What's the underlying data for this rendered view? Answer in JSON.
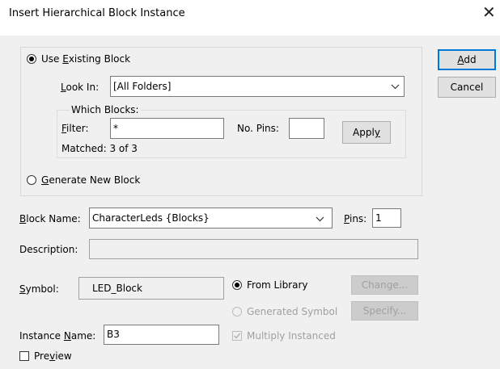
{
  "window": {
    "title": "Insert Hierarchical Block Instance",
    "close_glyph": "✕"
  },
  "use_existing": {
    "label": "Use Existing Block",
    "selected": true
  },
  "look_in": {
    "label": "Look In:",
    "value": "[All Folders]"
  },
  "which_blocks": {
    "legend": "Which Blocks:",
    "filter_label": "Filter:",
    "filter_value": "*",
    "pins_label": "No. Pins:",
    "pins_value": "",
    "apply_label": "Apply",
    "matched": "Matched: 3 of 3"
  },
  "generate_new": {
    "label": "Generate New Block",
    "selected": false
  },
  "block_name": {
    "label": "Block Name:",
    "value": "CharacterLeds {Blocks}"
  },
  "pins": {
    "label": "Pins:",
    "value": "1"
  },
  "description": {
    "label": "Description:",
    "value": ""
  },
  "symbol": {
    "label": "Symbol:",
    "value": "LED_Block"
  },
  "from_library": {
    "label": "From Library",
    "selected": true
  },
  "generated_symbol": {
    "label": "Generated Symbol",
    "selected": false
  },
  "change_label": "Change...",
  "specify_label": "Specify...",
  "instance_name": {
    "label": "Instance Name:",
    "value": "B3"
  },
  "multiply_instanced": {
    "label": "Multiply Instanced",
    "checked": true
  },
  "preview": {
    "label": "Preview",
    "checked": false
  },
  "buttons": {
    "add": "Add",
    "cancel": "Cancel"
  },
  "icons": {
    "checkmark": "✓",
    "dropdown": "chevron-down-icon"
  }
}
